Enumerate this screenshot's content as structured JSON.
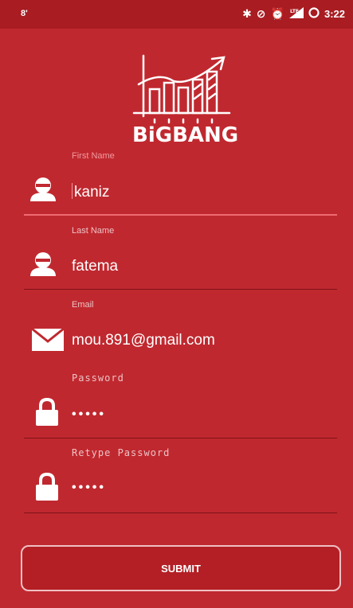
{
  "status_bar": {
    "left_indicator": "8'",
    "time": "3:22",
    "icons": [
      "bluetooth-icon",
      "do-not-disturb-icon",
      "alarm-icon",
      "lte-signal-icon",
      "battery-icon"
    ]
  },
  "logo": {
    "text": "BiGBANG"
  },
  "form": {
    "fields": [
      {
        "label": "First Name",
        "value": "kaniz",
        "icon": "person-icon",
        "focused": true
      },
      {
        "label": "Last Name",
        "value": "fatema",
        "icon": "person-icon",
        "focused": false
      },
      {
        "label": "Email",
        "value": "mou.891@gmail.com",
        "icon": "mail-icon",
        "focused": false
      },
      {
        "label": "Password",
        "value": "•••••",
        "icon": "lock-icon",
        "focused": false
      },
      {
        "label": "Retype Password",
        "value": "•••••",
        "icon": "lock-icon",
        "focused": false
      }
    ],
    "submit_label": "SUBMIT"
  },
  "colors": {
    "background": "#c0282f",
    "status_bar": "#a81c22",
    "focus_accent": "#f06a72"
  }
}
